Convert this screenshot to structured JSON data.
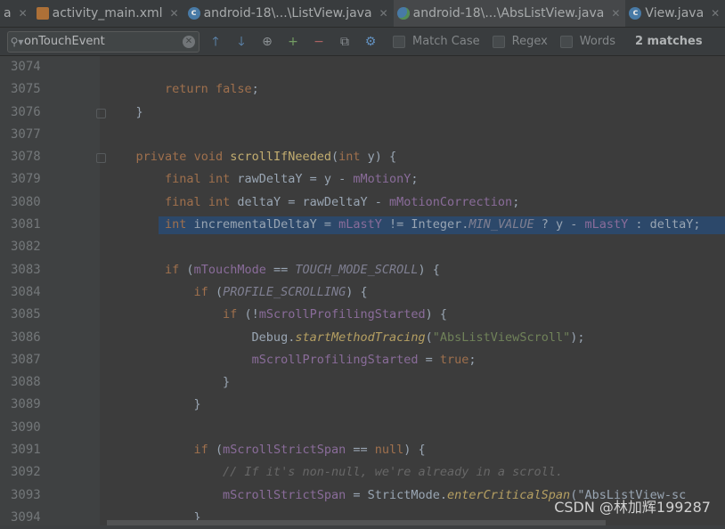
{
  "tabs": [
    {
      "label": "a",
      "icon": "none",
      "active": false
    },
    {
      "label": "activity_main.xml",
      "icon": "xml-file-icon",
      "active": false
    },
    {
      "label": "android-18\\...\\ListView.java",
      "icon": "class-icon",
      "active": false
    },
    {
      "label": "android-18\\...\\AbsListView.java",
      "icon": "globe-class-icon",
      "active": true
    },
    {
      "label": "View.java",
      "icon": "class-icon",
      "active": false
    }
  ],
  "search": {
    "value": "onTouchEvent",
    "options": [
      "Match Case",
      "Regex",
      "Words"
    ],
    "matches": "2 matches"
  },
  "code_lines": [
    {
      "num": "3074",
      "text": ""
    },
    {
      "num": "3075",
      "text": "        return false;"
    },
    {
      "num": "3076",
      "text": "    }"
    },
    {
      "num": "3077",
      "text": ""
    },
    {
      "num": "3078",
      "text": "    private void scrollIfNeeded(int y) {"
    },
    {
      "num": "3079",
      "text": "        final int rawDeltaY = y - mMotionY;"
    },
    {
      "num": "3080",
      "text": "        final int deltaY = rawDeltaY - mMotionCorrection;"
    },
    {
      "num": "3081",
      "text": "        int incrementalDeltaY = mLastY != Integer.MIN_VALUE ? y - mLastY : deltaY;"
    },
    {
      "num": "3082",
      "text": ""
    },
    {
      "num": "3083",
      "text": "        if (mTouchMode == TOUCH_MODE_SCROLL) {"
    },
    {
      "num": "3084",
      "text": "            if (PROFILE_SCROLLING) {"
    },
    {
      "num": "3085",
      "text": "                if (!mScrollProfilingStarted) {"
    },
    {
      "num": "3086",
      "text": "                    Debug.startMethodTracing(\"AbsListViewScroll\");"
    },
    {
      "num": "3087",
      "text": "                    mScrollProfilingStarted = true;"
    },
    {
      "num": "3088",
      "text": "                }"
    },
    {
      "num": "3089",
      "text": "            }"
    },
    {
      "num": "3090",
      "text": ""
    },
    {
      "num": "3091",
      "text": "            if (mScrollStrictSpan == null) {"
    },
    {
      "num": "3092",
      "text": "                // If it's non-null, we're already in a scroll."
    },
    {
      "num": "3093",
      "text": "                mScrollStrictSpan = StrictMode.enterCriticalSpan(\"AbsListView-sc"
    },
    {
      "num": "3094",
      "text": "            }"
    }
  ],
  "watermark": "CSDN @林加辉199287",
  "colors": {
    "background": "#3f3f3f",
    "selection": "#2d4d74",
    "keyword": "#b07a52"
  }
}
